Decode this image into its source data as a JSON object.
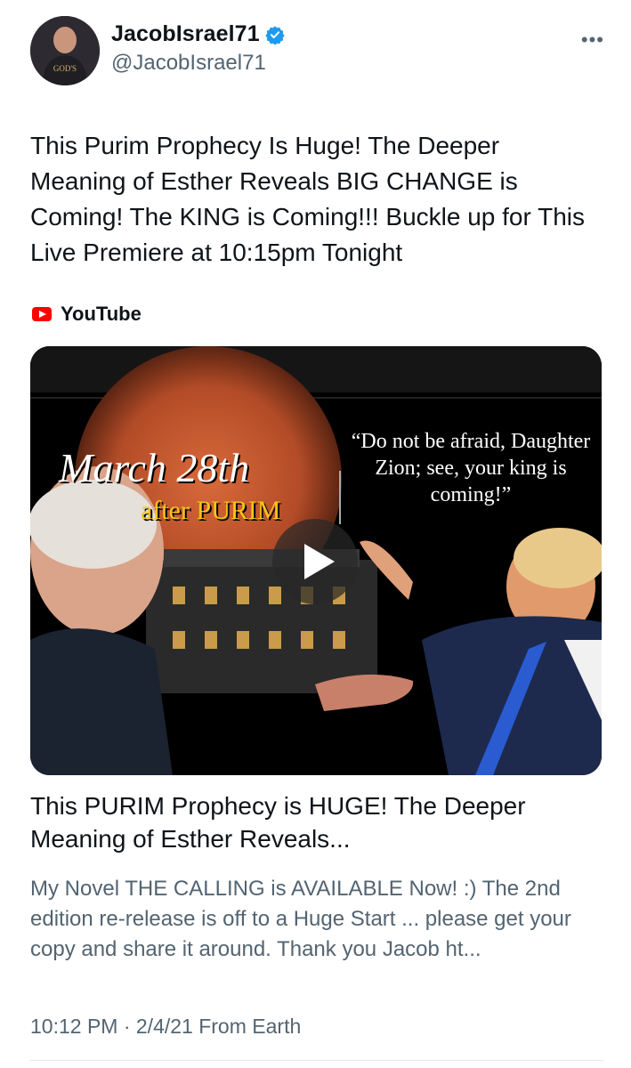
{
  "author": {
    "display_name": "JacobIsrael71",
    "handle": "@JacobIsrael71",
    "verified": true,
    "avatar_shirt_text": "GOD'S"
  },
  "more_label": "•••",
  "tweet": {
    "text": "This Purim Prophecy Is Huge! The Deeper Meaning of Esther Reveals BIG CHANGE is Coming! The KING is Coming!!! Buckle up for This Live Premiere at 10:15pm Tonight"
  },
  "card": {
    "source": "YouTube",
    "thumbnail": {
      "title_line1": "March 28th",
      "title_line2": "after PURIM",
      "quote": "“Do not be afraid, Daughter Zion; see, your king is coming!”"
    },
    "title": "This PURIM Prophecy is HUGE! The Deeper Meaning of Esther Reveals...",
    "description": "My Novel THE CALLING is AVAILABLE Now! :) The 2nd edition re-release is off to a Huge Start ... please get your copy and share it around. Thank you Jacob ht..."
  },
  "meta": {
    "text": "10:12 PM · 2/4/21 From Earth"
  },
  "colors": {
    "accent_blue": "#1d9bf0",
    "youtube_red": "#ff0000",
    "secondary_text": "#536471"
  }
}
